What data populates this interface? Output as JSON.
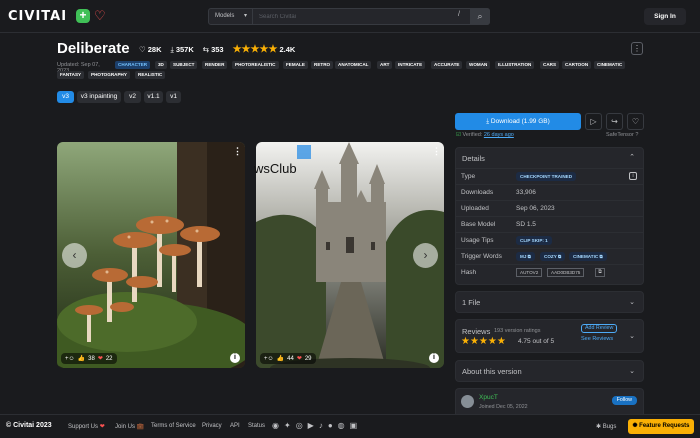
{
  "header": {
    "logo": "CIVITAI",
    "search_type": "Models",
    "search_placeholder": "Search Civitai",
    "shortcut": "/",
    "signin": "Sign In"
  },
  "model": {
    "title": "Deliberate",
    "likes": "28K",
    "downloads": "357K",
    "comments": "353",
    "rating_count": "2.4K",
    "rating": 5,
    "updated": "Updated: Sep 07, 2023",
    "tags_row1": [
      "CHARACTER",
      "3D",
      "SUBJECT",
      "RENDER",
      "PHOTOREALISTIC",
      "FEMALE",
      "RETRO",
      "ANATOMICAL",
      "ART",
      "INTRICATE",
      "ACCURATE",
      "WOMAN",
      "ILLUSTRATION",
      "CARS",
      "CARTOON",
      "CINEMATIC"
    ],
    "tags_row2": [
      "FANTASY",
      "PHOTOGRAPHY",
      "REALISTIC"
    ],
    "versions": [
      "v3",
      "v3 inpainting",
      "v2",
      "v1.1",
      "v1"
    ],
    "active_version": "v3"
  },
  "gallery": {
    "cards": [
      {
        "name": "mushrooms",
        "likes": "38",
        "hearts": "22"
      },
      {
        "name": "castle",
        "likes": "44",
        "hearts": "29"
      }
    ],
    "watermark": "wsClub"
  },
  "sidebar": {
    "download_label": "Download (1.99 GB)",
    "verified_prefix": "Verified:",
    "verified_date": "26 days ago",
    "safetensor": "SafeTensor",
    "details_title": "Details",
    "details": {
      "type_label": "Type",
      "type_value": "CHECKPOINT TRAINED",
      "downloads_label": "Downloads",
      "downloads_value": "33,906",
      "uploaded_label": "Uploaded",
      "uploaded_value": "Sep 06, 2023",
      "base_label": "Base Model",
      "base_value": "SD 1.5",
      "usage_label": "Usage Tips",
      "usage_value": "CLIP SKIP: 1",
      "trigger_label": "Trigger Words",
      "triggers": [
        "MJ",
        "COZY",
        "CINEMATIC"
      ],
      "hash_label": "Hash",
      "hash_type": "AUTOV2",
      "hash_value": "AAD0DB3D75"
    },
    "files_title": "1 File",
    "reviews_title": "Reviews",
    "reviews_count": "193 version ratings",
    "reviews_score": "4.75 out of 5",
    "add_review": "Add Review",
    "see_reviews": "See Reviews",
    "about_title": "About this version",
    "creator_name": "XpucT",
    "creator_joined": "Joined Dec 05, 2022",
    "follow": "Follow"
  },
  "footer": {
    "copyright": "© Civitai 2023",
    "links": [
      "Support Us",
      "Join Us",
      "Terms of Service",
      "Privacy",
      "API",
      "Status"
    ],
    "bugs": "Bugs",
    "feature_requests": "Feature Requests"
  },
  "colors": {
    "accent": "#228be6",
    "star": "#fab005",
    "feature": "#fab005"
  }
}
